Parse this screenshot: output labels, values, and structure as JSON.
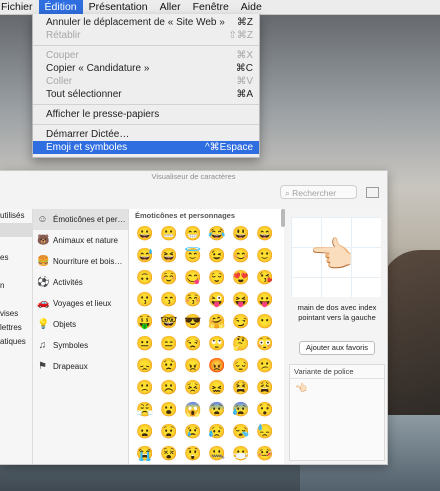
{
  "menubar": {
    "items": [
      "Fichier",
      "Édition",
      "Présentation",
      "Aller",
      "Fenêtre",
      "Aide"
    ],
    "active_index": 1
  },
  "edit_menu": {
    "items": [
      {
        "label": "Annuler le déplacement de « Site Web »",
        "shortcut": "⌘Z",
        "disabled": false
      },
      {
        "label": "Rétablir",
        "shortcut": "⇧⌘Z",
        "disabled": true
      },
      {
        "label": "Couper",
        "shortcut": "⌘X",
        "disabled": true
      },
      {
        "label": "Copier « Candidature »",
        "shortcut": "⌘C",
        "disabled": false
      },
      {
        "label": "Coller",
        "shortcut": "⌘V",
        "disabled": true
      },
      {
        "label": "Tout sélectionner",
        "shortcut": "⌘A",
        "disabled": false
      },
      {
        "label": "Afficher le presse-papiers",
        "shortcut": "",
        "disabled": false
      },
      {
        "label": "Démarrer Dictée…",
        "shortcut": "",
        "disabled": false
      },
      {
        "label": "Emoji et symboles",
        "shortcut": "^⌘Espace",
        "disabled": false,
        "highlighted": true
      }
    ]
  },
  "viewer": {
    "title": "Visualiseur de caractères",
    "search_placeholder": "Rechercher",
    "left_fragments": [
      "utilisés",
      "",
      "",
      "es",
      "",
      "n",
      "",
      "vises",
      "lettres",
      "atiques"
    ],
    "categories": [
      {
        "label": "Émoticônes et per…",
        "icon": "smiley-icon",
        "glyph": "☺"
      },
      {
        "label": "Animaux et nature",
        "icon": "animal-icon",
        "glyph": "🐻"
      },
      {
        "label": "Nourriture et bois…",
        "icon": "food-icon",
        "glyph": "🍔"
      },
      {
        "label": "Activités",
        "icon": "ball-icon",
        "glyph": "⚽"
      },
      {
        "label": "Voyages et lieux",
        "icon": "car-icon",
        "glyph": "🚗"
      },
      {
        "label": "Objets",
        "icon": "bulb-icon",
        "glyph": "💡"
      },
      {
        "label": "Symboles",
        "icon": "symbols-icon",
        "glyph": "♫"
      },
      {
        "label": "Drapeaux",
        "icon": "flag-icon",
        "glyph": "⚑"
      }
    ],
    "grid_title": "Émoticônes et personnages",
    "emojis": [
      "😀",
      "😬",
      "😁",
      "😂",
      "😃",
      "😄",
      "😅",
      "😆",
      "😇",
      "😉",
      "😊",
      "🙂",
      "🙃",
      "☺️",
      "😋",
      "😌",
      "😍",
      "😘",
      "😗",
      "😙",
      "😚",
      "😜",
      "😝",
      "😛",
      "🤑",
      "🤓",
      "😎",
      "🤗",
      "😏",
      "😶",
      "😐",
      "😑",
      "😒",
      "🙄",
      "🤔",
      "😳",
      "😞",
      "😟",
      "😠",
      "😡",
      "😔",
      "😕",
      "🙁",
      "☹️",
      "😣",
      "😖",
      "😫",
      "😩",
      "😤",
      "😮",
      "😱",
      "😨",
      "😰",
      "😯",
      "😦",
      "😧",
      "😢",
      "😥",
      "😪",
      "😓",
      "😭",
      "😵",
      "😲",
      "🤐",
      "😷",
      "🤒"
    ],
    "preview_glyph": "👈🏻",
    "description": "main de dos avec index pointant vers la gauche",
    "favorite_button": "Ajouter aux favoris",
    "variants_title": "Variante de police",
    "variant_glyph": "👈🏻"
  }
}
